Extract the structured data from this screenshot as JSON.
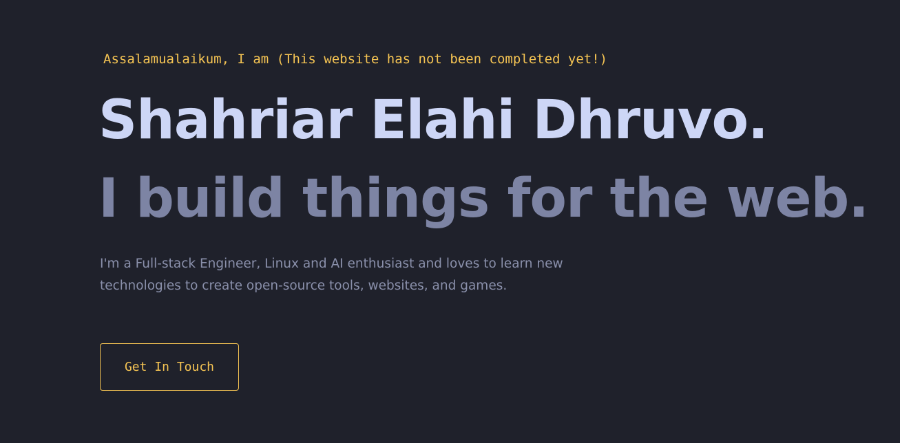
{
  "hero": {
    "greeting": "Assalamualaikum, I am (This website has not been completed yet!)",
    "name": "Shahriar Elahi Dhruvo.",
    "tagline": "I build things for the web.",
    "bio": "I'm a Full-stack Engineer, Linux and AI enthusiast and loves to learn new technologies to create open-source tools, websites, and games.",
    "cta_label": "Get In Touch"
  },
  "colors": {
    "background": "#1f212b",
    "accent": "#f5c453",
    "name": "#cdd6f6",
    "tagline": "#7d84a4",
    "body_text": "#8a90ab"
  }
}
